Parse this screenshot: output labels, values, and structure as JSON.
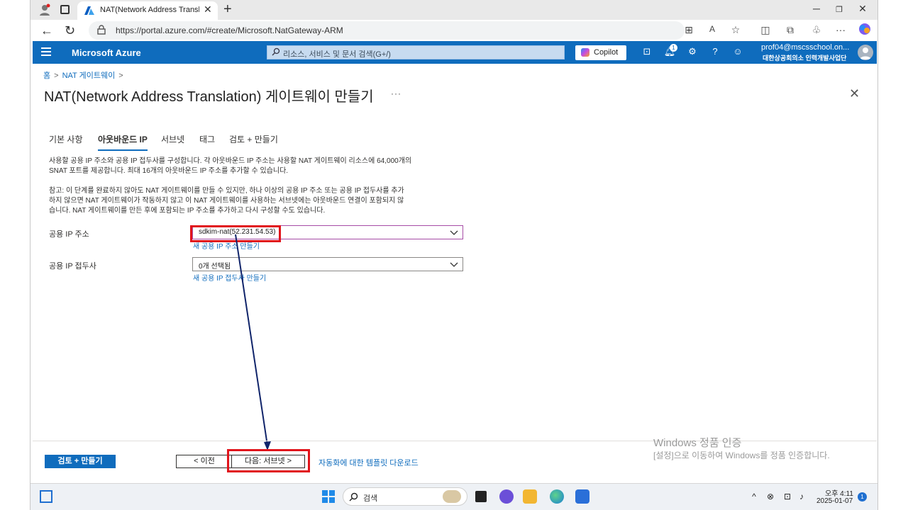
{
  "browser": {
    "tab_title": "NAT(Network Address Translation",
    "url": "https://portal.azure.com/#create/Microsoft.NatGateway-ARM"
  },
  "azure": {
    "brand": "Microsoft Azure",
    "search_placeholder": "리소스, 서비스 및 문서 검색(G+/)",
    "copilot_label": "Copilot",
    "notification_count": "1",
    "account_name": "prof04@mscsschool.on...",
    "account_org": "대한상공회의소 인력개발사업단"
  },
  "breadcrumb": {
    "home": "홈",
    "parent": "NAT 게이트웨이"
  },
  "page": {
    "title": "NAT(Network Address Translation) 게이트웨이 만들기",
    "more": "···"
  },
  "tabs": [
    {
      "label": "기본 사항"
    },
    {
      "label": "아웃바운드 IP"
    },
    {
      "label": "서브넷"
    },
    {
      "label": "태그"
    },
    {
      "label": "검토 + 만들기"
    }
  ],
  "description": {
    "line1": "사용할 공용 IP 주소와 공용 IP 접두사를 구성합니다. 각 아웃바운드 IP 주소는 사용할 NAT 게이트웨이 리소스에 64,000개의",
    "line2": "SNAT 포트를 제공합니다. 최대 16개의 아웃바운드 IP 주소를 추가할 수 있습니다.",
    "note1": "참고: 이 단계를 완료하지 않아도 NAT 게이트웨이를 만들 수 있지만, 하나 이상의 공용 IP 주소 또는 공용 IP 접두사를 추가",
    "note2": "하지 않으면 NAT 게이트웨이가 작동하지 않고 이 NAT 게이트웨이를 사용하는 서브넷에는 아웃바운드 연결이 포함되지 않",
    "note3": "습니다. NAT 게이트웨이를 만든 후에 포함되는 IP 주소를 추가하고 다시 구성할 수도 있습니다."
  },
  "form": {
    "public_ip": {
      "label": "공용 IP 주소",
      "value": "sdkim-nat(52.231.54.53)",
      "create_link": "새 공용 IP 주소 만들기"
    },
    "public_prefix": {
      "label": "공용 IP 접두사",
      "value": "0개 선택됨",
      "create_link": "새 공용 IP 접두사 만들기"
    }
  },
  "footer": {
    "review_create": "검토 + 만들기",
    "previous": "< 이전",
    "next": "다음: 서브넷 >",
    "template_link": "자동화에 대한 템플릿 다운로드"
  },
  "watermark": {
    "line1": "Windows 정품 인증",
    "line2": "[설정]으로 이동하여 Windows를 정품 인증합니다."
  },
  "taskbar": {
    "search_placeholder": "검색",
    "time": "오후 4:11",
    "date": "2025-01-07",
    "notification_count": "1"
  },
  "colors": {
    "azure_blue": "#0f6cbd",
    "highlight_red": "#e1141b",
    "arrow_navy": "#10246a"
  }
}
